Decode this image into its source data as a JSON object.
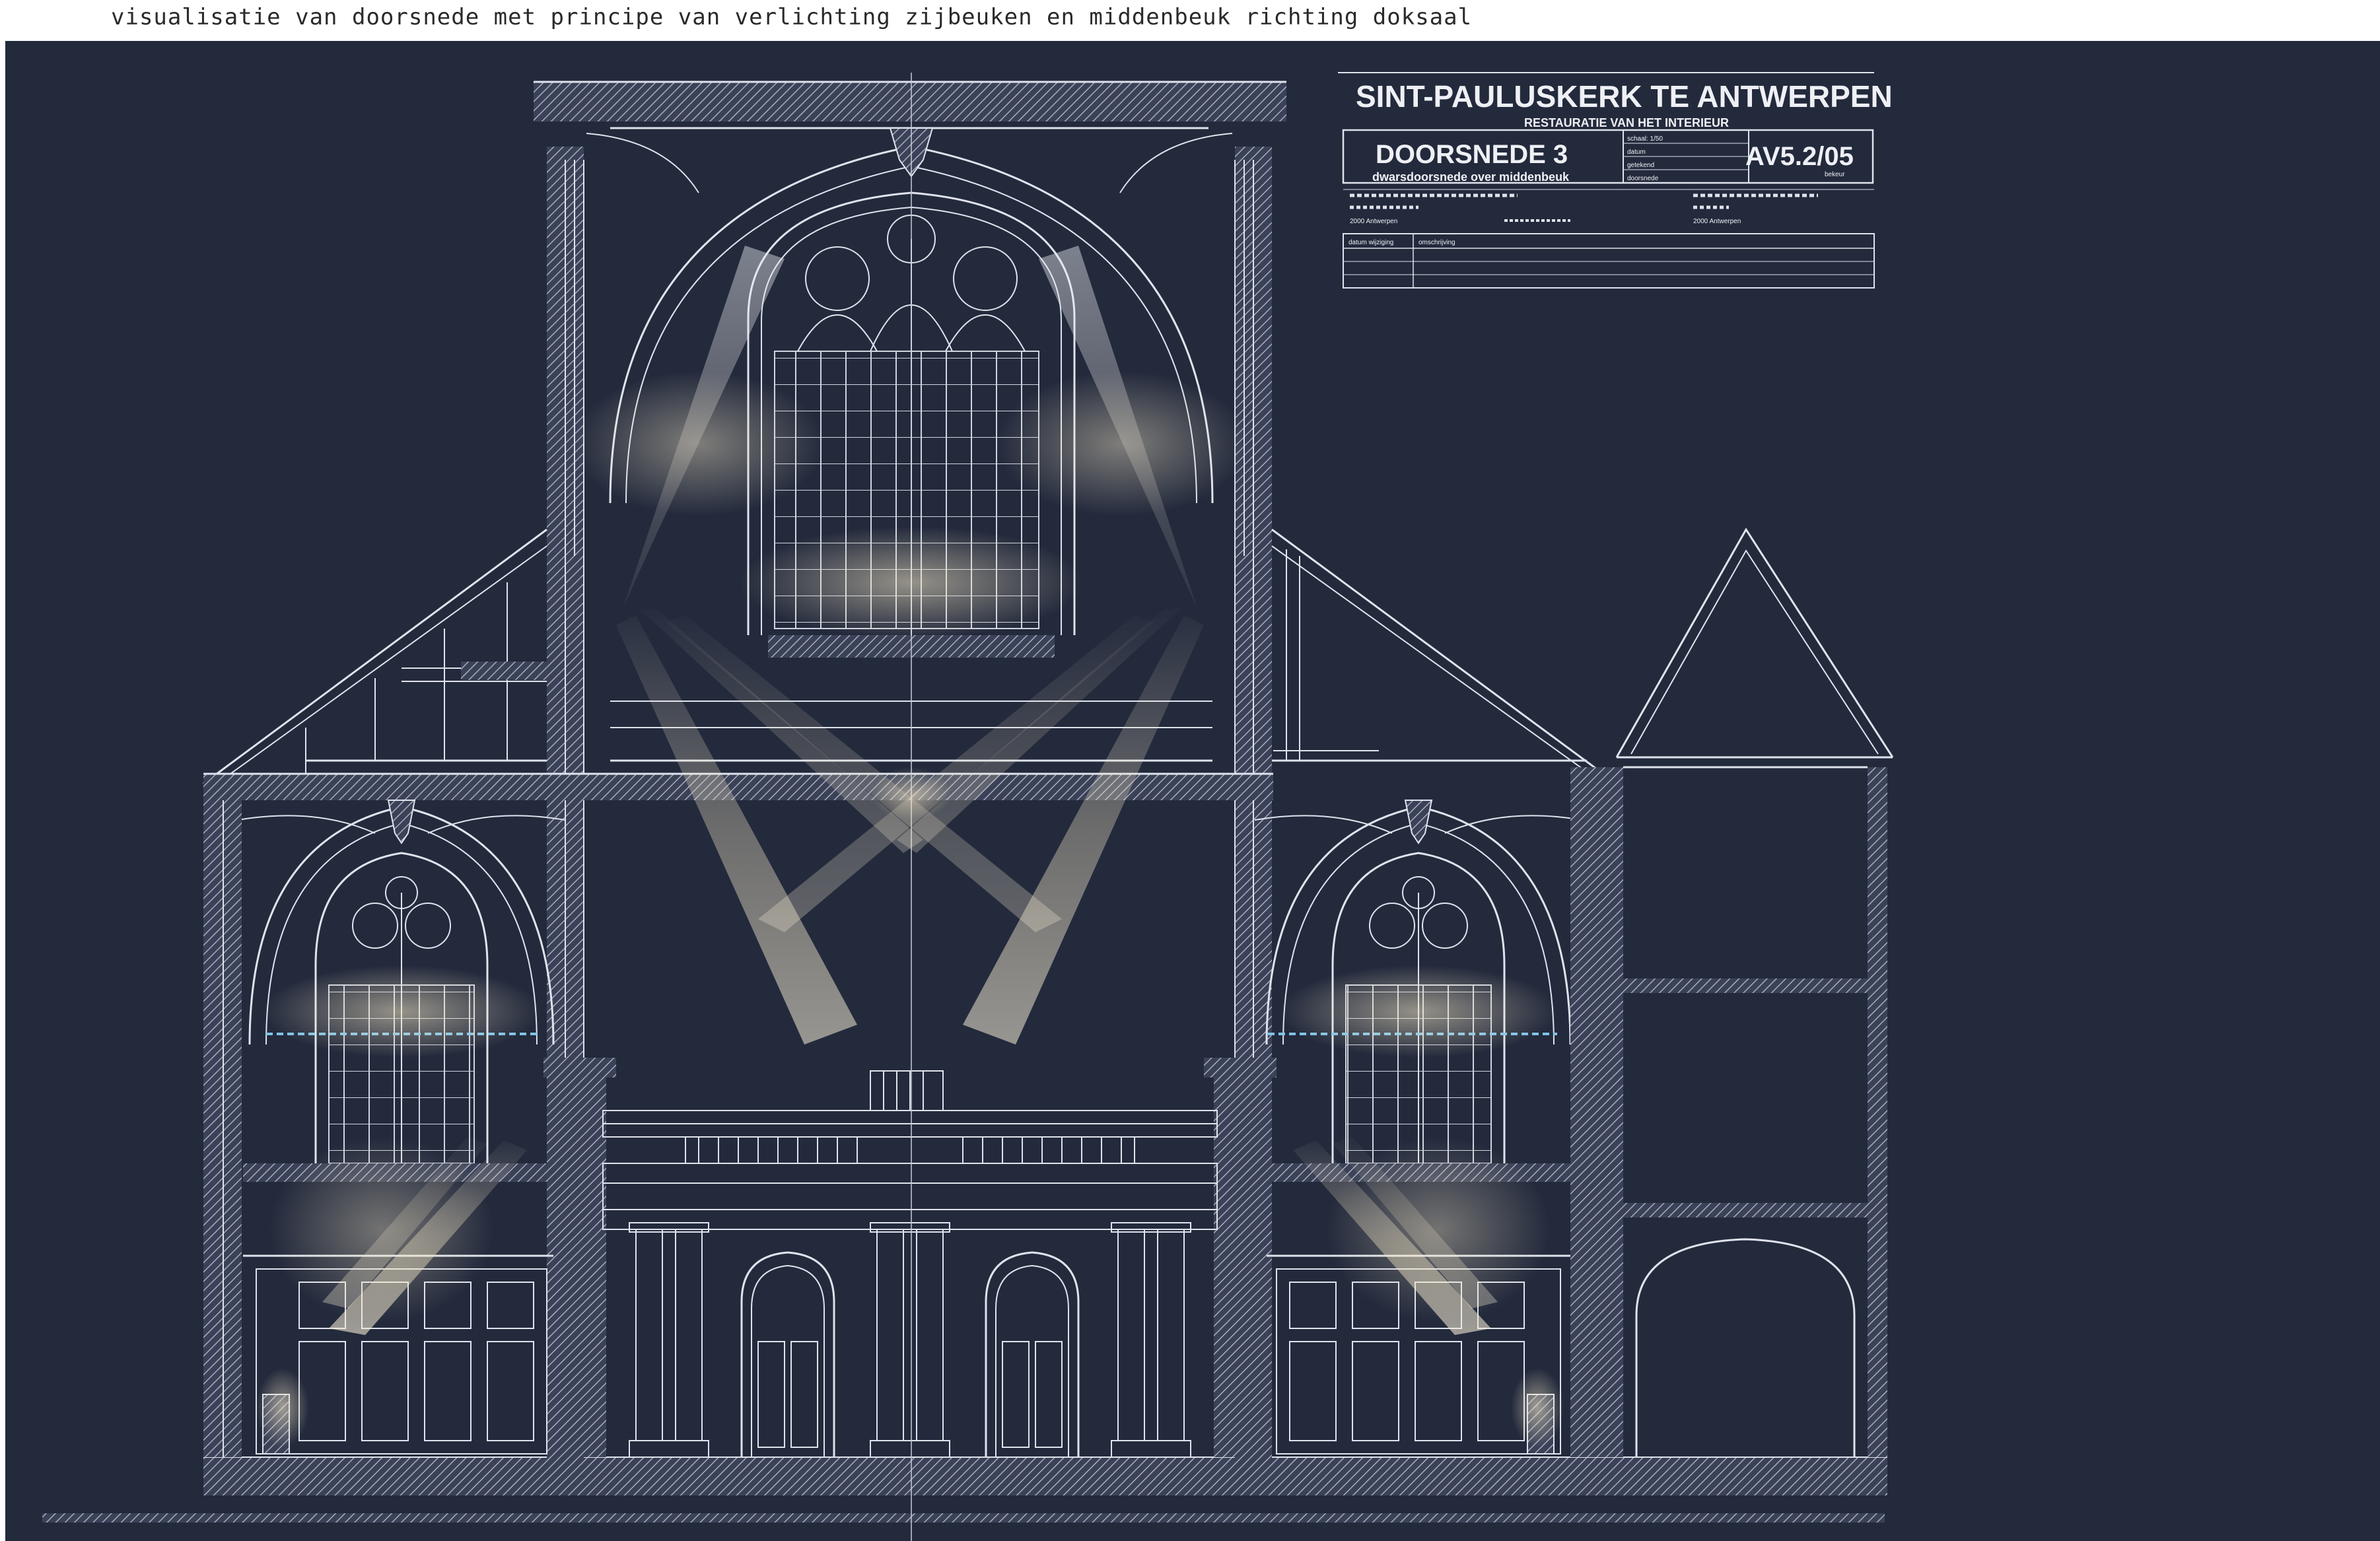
{
  "caption": "visualisatie van doorsnede met principe van verlichting zijbeuken en middenbeuk richting doksaal",
  "title_block": {
    "project": "SINT-PAULUSKERK TE ANTWERPEN",
    "subtitle": "RESTAURATIE VAN HET INTERIEUR",
    "drawing_title": "DOORSNEDE 3",
    "drawing_subtitle": "dwarsdoorsnede over middenbeuk",
    "drawing_number": "AV5.2/05",
    "scale": "schaal: 1/50",
    "field_datum": "datum",
    "field_getekend": "getekend",
    "field_doorsnede": "doorsnede",
    "field_blad": "bekeur",
    "architect_city": "2000 Antwerpen",
    "owner_city": "2000 Antwerpen",
    "revision_date_label": "datum wijziging",
    "revision_desc_label": "omschrijving"
  },
  "colors": {
    "background": "#232a3c",
    "line": "#dfe3ec",
    "hatch": "#8f97ab",
    "light": "#f1e7cf",
    "dashed": "#7ec4e6"
  }
}
